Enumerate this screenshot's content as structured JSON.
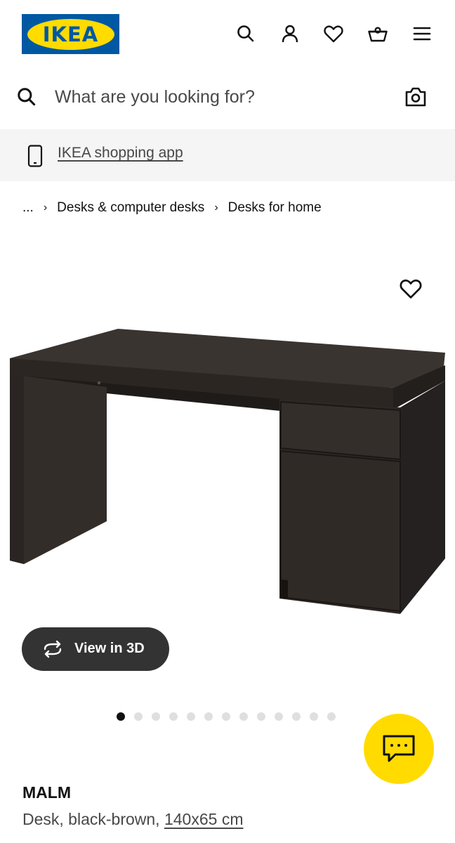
{
  "header": {
    "logo_text": "IKEA",
    "icons": [
      "search-icon",
      "account-icon",
      "heart-icon",
      "basket-icon",
      "menu-icon"
    ]
  },
  "search": {
    "placeholder": "What are you looking for?"
  },
  "app_banner": {
    "label": "IKEA shopping app"
  },
  "breadcrumb": {
    "ellipsis": "...",
    "items": [
      "Desks & computer desks",
      "Desks for home"
    ],
    "separator": "›"
  },
  "gallery": {
    "view3d_label": "View in 3D",
    "dot_count": 13,
    "active_dot": 0
  },
  "product": {
    "name": "MALM",
    "description": "Desk, black-brown, ",
    "dimensions": "140x65 cm"
  },
  "colors": {
    "brand_blue": "#0058a3",
    "brand_yellow": "#ffdb00",
    "dark_button": "#333333",
    "desk_color": "#2f2a26"
  }
}
